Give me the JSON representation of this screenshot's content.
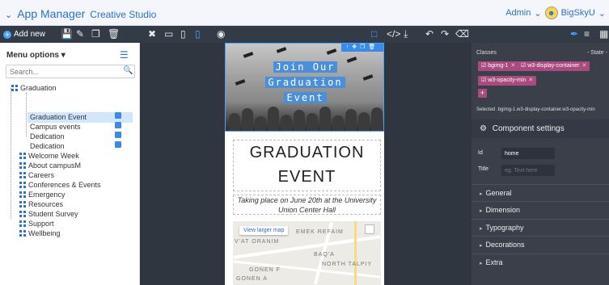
{
  "header": {
    "app_title": "App Manager",
    "sub_title": "Creative Studio",
    "user_label": "Admin",
    "account_label": "BigSkyU"
  },
  "toolbar": {
    "add_new_label": "Add new"
  },
  "sidebar": {
    "menu_options_label": "Menu options",
    "search_placeholder": "Search...",
    "items": [
      {
        "label": "Graduation"
      },
      {
        "label": "Graduation Event"
      },
      {
        "label": "Campus events"
      },
      {
        "label": "Dedication"
      },
      {
        "label": "Dedication"
      },
      {
        "label": "Welcome Week"
      },
      {
        "label": "About campusM"
      },
      {
        "label": "Careers"
      },
      {
        "label": "Conferences & Events"
      },
      {
        "label": "Emergency"
      },
      {
        "label": "Resources"
      },
      {
        "label": "Student Survey"
      },
      {
        "label": "Support"
      },
      {
        "label": "Wellbeing"
      }
    ]
  },
  "canvas": {
    "hero_line1": "Join Our",
    "hero_line2": "Graduation",
    "hero_line3": "Event",
    "heading_line1": "GRADUATION",
    "heading_line2": "EVENT",
    "subheading_line1": "Taking place on June 20th at the University",
    "subheading_line2": "Union Center Hall",
    "map_larger_link": "View larger map",
    "map_labels": [
      "EMEK REFAIM",
      "V'AT ORANIM",
      "BAQ'A",
      "NORTH TALPIY",
      "GONEN F",
      "GONEN A"
    ]
  },
  "right_panel": {
    "classes_label": "Classes",
    "state_label": "- State -",
    "class_tags": [
      "bgimg-1",
      "w3-display-container",
      "w3-opacity-min"
    ],
    "selected_text": "Selected .bgimg-1.w3-display-container.w3-opacity-min",
    "component_settings_label": "Component settings",
    "id_label": "Id",
    "id_value": "home",
    "title_label": "Title",
    "title_placeholder": "eg. Text here",
    "sections": [
      "General",
      "Dimension",
      "Typography",
      "Decorations",
      "Extra"
    ]
  },
  "colors": {
    "accent": "#2b70c9",
    "toolbar_bg": "#333b46",
    "panel_bg": "#3b3f4a",
    "tag_bg": "#a94a80",
    "selected_row": "#d2e7fb"
  }
}
